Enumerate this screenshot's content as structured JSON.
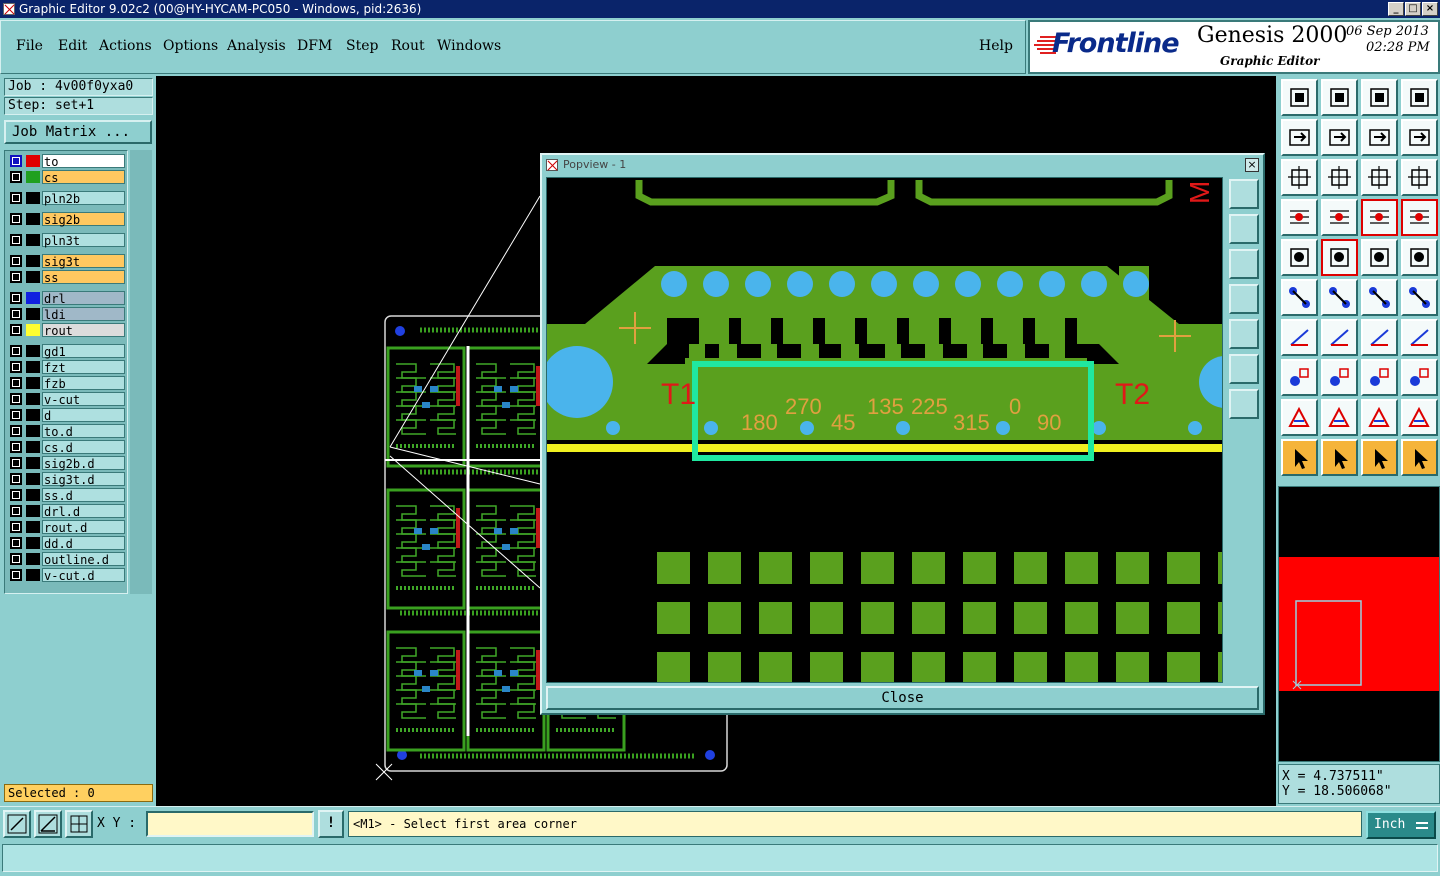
{
  "window": {
    "title": "Graphic Editor 9.02c2 (00@HY-HYCAM-PC050 - Windows, pid:2636)",
    "minimize": "_",
    "maximize": "□",
    "close": "×"
  },
  "menu": [
    "File",
    "Edit",
    "Actions",
    "Options",
    "Analysis",
    "DFM",
    "Step",
    "Rout",
    "Windows"
  ],
  "help_label": "Help",
  "brand": {
    "logo": "Frontline",
    "product": "Genesis 2000",
    "subtitle": "Graphic Editor",
    "date": "06  Sep  2013",
    "time": "02:28  PM"
  },
  "job": {
    "job_label": "Job : 4v00f0yxa0",
    "step_label": "Step: set+1",
    "matrix_button": "Job Matrix ..."
  },
  "layers": [
    {
      "name": "to",
      "swatch": "#e00000",
      "bg": "#ffffff",
      "marker": "#1010c0"
    },
    {
      "name": "cs",
      "swatch": "#20a020",
      "bg": "#ffc860"
    },
    {
      "name": "pln2b",
      "swatch": "",
      "bg": "#aee0e0"
    },
    {
      "name": "sig2b",
      "swatch": "",
      "bg": "#ffc860"
    },
    {
      "name": "pln3t",
      "swatch": "",
      "bg": "#aee0e0"
    },
    {
      "name": "sig3t",
      "swatch": "",
      "bg": "#ffc860"
    },
    {
      "name": "ss",
      "swatch": "",
      "bg": "#ffc860"
    },
    {
      "name": "drl",
      "swatch": "#1020e0",
      "bg": "#a0b8c8"
    },
    {
      "name": "ldi",
      "swatch": "",
      "bg": "#a0b8c8"
    },
    {
      "name": "rout",
      "swatch": "#ffff30",
      "bg": "#dcdcdc"
    },
    {
      "name": "gd1",
      "swatch": "",
      "bg": "#aee0e0"
    },
    {
      "name": "fzt",
      "swatch": "",
      "bg": "#aee0e0"
    },
    {
      "name": "fzb",
      "swatch": "",
      "bg": "#aee0e0"
    },
    {
      "name": "v-cut",
      "swatch": "",
      "bg": "#aee0e0"
    },
    {
      "name": "d",
      "swatch": "",
      "bg": "#aee0e0"
    },
    {
      "name": "to.d",
      "swatch": "",
      "bg": "#aee0e0"
    },
    {
      "name": "cs.d",
      "swatch": "",
      "bg": "#aee0e0"
    },
    {
      "name": "sig2b.d",
      "swatch": "",
      "bg": "#aee0e0"
    },
    {
      "name": "sig3t.d",
      "swatch": "",
      "bg": "#aee0e0"
    },
    {
      "name": "ss.d",
      "swatch": "",
      "bg": "#aee0e0"
    },
    {
      "name": "drl.d",
      "swatch": "",
      "bg": "#aee0e0"
    },
    {
      "name": "rout.d",
      "swatch": "",
      "bg": "#aee0e0"
    },
    {
      "name": "dd.d",
      "swatch": "",
      "bg": "#aee0e0"
    },
    {
      "name": "outline.d",
      "swatch": "",
      "bg": "#aee0e0"
    },
    {
      "name": "v-cut.d",
      "swatch": "",
      "bg": "#aee0e0"
    }
  ],
  "selected_label": "Selected : 0",
  "popview": {
    "title": "Popview - 1",
    "close_button": "Close",
    "labels": {
      "t1": "T1",
      "t2": "T2",
      "corner": "M P",
      "angles": [
        "180",
        "270",
        "45",
        "135",
        "225",
        "315",
        "0",
        "90"
      ]
    }
  },
  "coords": {
    "x": "X  =  4.737511\"",
    "y": "Y  =  18.506068\""
  },
  "bottom": {
    "xy_label": "X Y :",
    "xy_value": "",
    "prompt_icon": "!",
    "message": "<M1> - Select first area corner",
    "units": "Inch"
  },
  "colors": {
    "panel_bg": "#8ecfcf",
    "copper_green": "#5aa01e",
    "pad_blue": "#4ab4ec",
    "highlight_box": "#20e8a0",
    "label_red": "#e01818",
    "label_orange": "#e0a040",
    "rout_yellow": "#f0f020"
  },
  "tools": [
    "zoom-home-icon",
    "zoom-in-icon",
    "home-icon",
    "split-view-icon",
    "pan-left-icon",
    "pan-right-icon",
    "flip-icon",
    "redraw-icon",
    "fit-icon",
    "center-icon",
    "one-to-one-icon",
    "query-icon",
    "measure-settings-icon",
    "grid-icon",
    "snap-icon",
    "snap-alt-icon",
    "select-icon",
    "draw-icon",
    "ruler-icon",
    "pad-icon",
    "connect-icon",
    "cross-icon",
    "line-add-icon",
    "arc-add-icon",
    "angle-icon",
    "slash-icon",
    "curve-icon",
    "text-icon",
    "pad-edit-icon",
    "minus-icon",
    "split-pads-icon",
    "copy-pads-icon",
    "triangle-icon",
    "triangle-a-icon",
    "triangle-a2-icon",
    "triangle-a3-icon",
    "pointer-icon",
    "pointer-box-icon",
    "pointer-box2-icon",
    "route-icon"
  ]
}
